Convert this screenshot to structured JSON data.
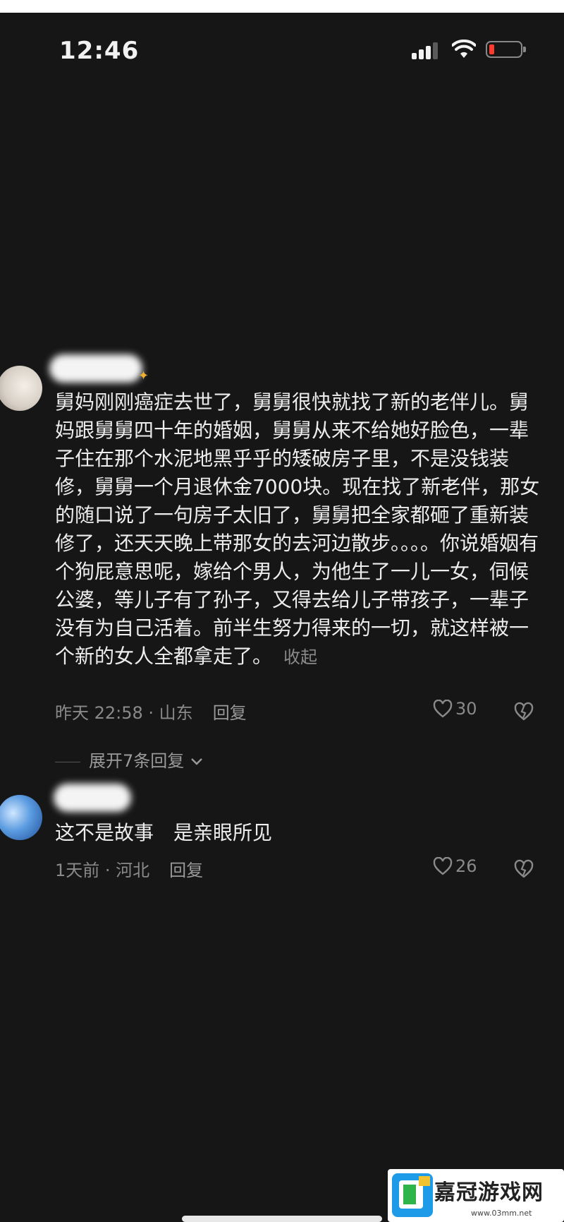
{
  "status_bar": {
    "time": "12:46"
  },
  "comments": [
    {
      "text": "舅妈刚刚癌症去世了，舅舅很快就找了新的老伴儿。舅妈跟舅舅四十年的婚姻，舅舅从来不给她好脸色，一辈子住在那个水泥地黑乎乎的矮破房子里，不是没钱装修，舅舅一个月退休金7000块。现在找了新老伴，那女的随口说了一句房子太旧了，舅舅把全家都砸了重新装修了，还天天晚上带那女的去河边散步。。。。你说婚姻有个狗屁意思呢，嫁给个男人，为他生了一儿一女，伺候公婆，等儿子有了孙子，又得去给儿子带孩子，一辈子没有为自己活着。前半生努力得来的一切，就这样被一个新的女人全都拿走了。",
      "collapse": "收起",
      "time_location": "昨天 22:58 · 山东",
      "reply": "回复",
      "likes": "30"
    },
    {
      "text": "这不是故事　是亲眼所见",
      "time_location": "1天前 · 河北",
      "reply": "回复",
      "likes": "26"
    }
  ],
  "expand_replies": "展开7条回复",
  "watermark": {
    "brand": "嘉冠游戏网",
    "url": "www.03mm.net"
  },
  "colors": {
    "background": "#161616",
    "text": "#ededed",
    "muted": "#8a8a8a",
    "battery_low": "#ff3b30"
  },
  "icons": [
    "signal-icon",
    "wifi-icon",
    "battery-icon",
    "heart-icon",
    "dislike-heart-icon",
    "chevron-down-icon"
  ]
}
